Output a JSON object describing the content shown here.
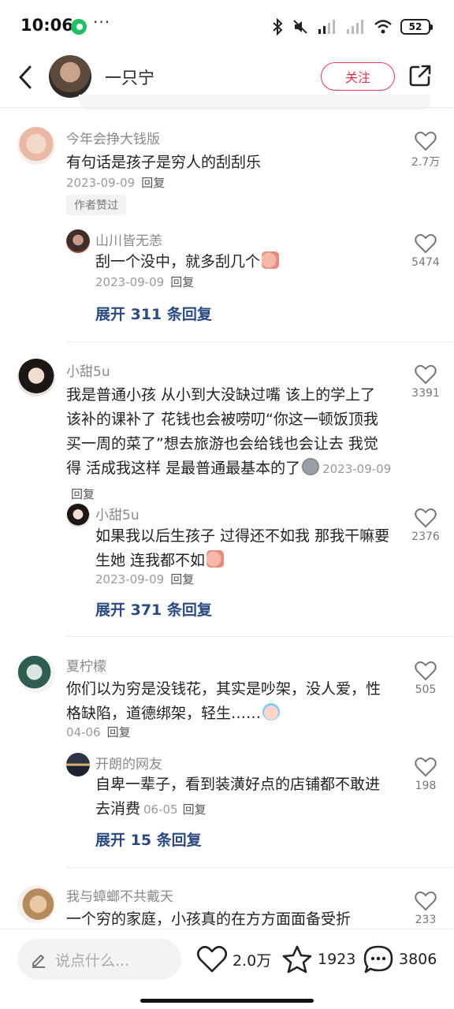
{
  "status_bar": {
    "time": "10:06",
    "more": "···",
    "battery": "52"
  },
  "header": {
    "username": "一只宁",
    "follow_label": "关注"
  },
  "comments": [
    {
      "name": "今年会挣大钱版",
      "text": "有句话是孩子是穷人的刮刮乐",
      "date": "2023-09-09",
      "reply_label": "回复",
      "likes": "2.7万",
      "badge": "作者赞过",
      "reply": {
        "name": "山川皆无恙",
        "text": "刮一个没中，就多刮几个",
        "date": "2023-09-09",
        "reply_label": "回复",
        "likes": "5474"
      },
      "expand": "展开 311 条回复"
    },
    {
      "name": "小甜5u",
      "text": "我是普通小孩 从小到大没缺过嘴 该上的学上了 该补的课补了 花钱也会被唠叨“你这一顿饭顶我买一周的菜了”想去旅游也会给钱也会让去 我觉得 活成我这样 是最普通最基本的了",
      "date": "2023-09-09",
      "reply_label": "回复",
      "likes": "3391",
      "reply": {
        "name": "小甜5u",
        "text": "如果我以后生孩子 过得还不如我 那我干嘛要生她 连我都不如",
        "date": "2023-09-09",
        "reply_label": "回复",
        "likes": "2376"
      },
      "expand": "展开 371 条回复"
    },
    {
      "name": "夏柠檬",
      "text": "你们以为穷是没钱花，其实是吵架，没人爱，性格缺陷，道德绑架，轻生……",
      "date": "04-06",
      "reply_label": "回复",
      "likes": "505",
      "reply": {
        "name": "开朗的网友",
        "text": "自卑一辈子，看到装潢好点的店铺都不敢进去消费",
        "date": "06-05",
        "reply_label": "回复",
        "likes": "198"
      },
      "expand": "展开 15 条回复"
    },
    {
      "name": "我与蟑螂不共戴天",
      "text": "一个穷的家庭，小孩真的在方方面面备受折",
      "likes": "233"
    }
  ],
  "bottom_bar": {
    "input_placeholder": "说点什么...",
    "likes": "2.0万",
    "collects": "1923",
    "comments": "3806"
  }
}
